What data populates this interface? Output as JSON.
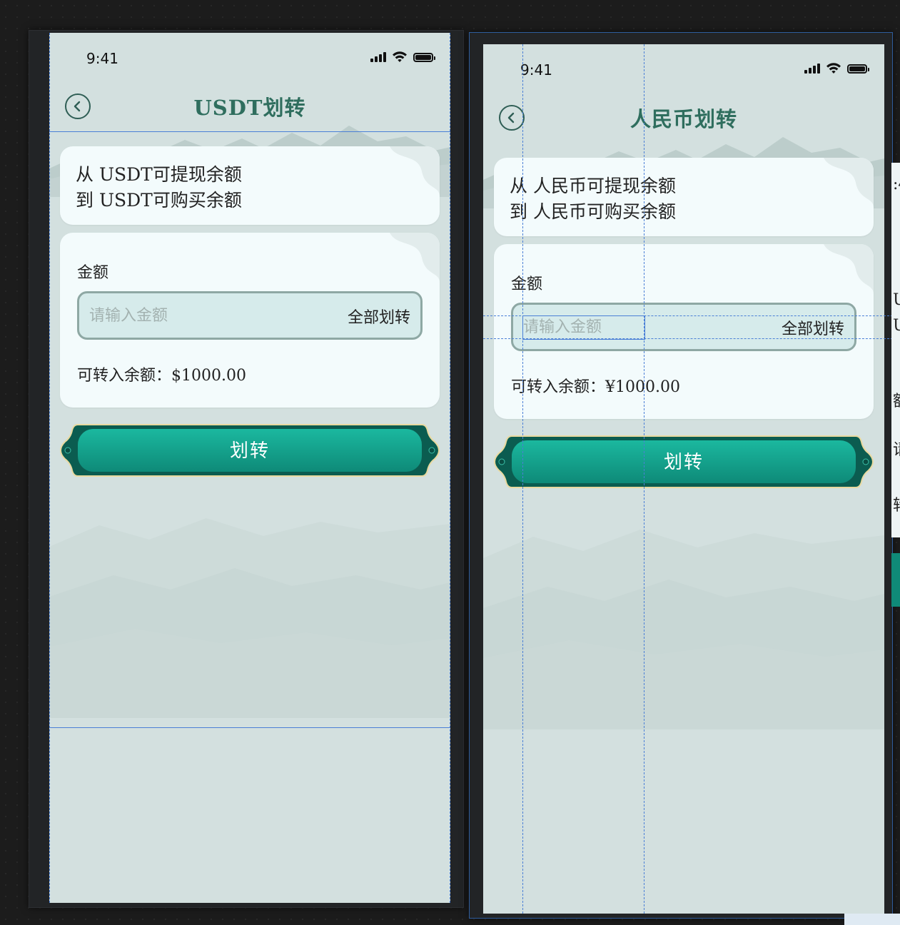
{
  "screens": [
    {
      "status": {
        "time": "9:41"
      },
      "nav": {
        "title": "USDT划转"
      },
      "info": {
        "from_text": "从 USDT可提现余额",
        "to_text": "到 USDT可购买余额"
      },
      "form": {
        "amount_label": "金额",
        "amount_placeholder": "请输入金额",
        "amount_value": "",
        "transfer_all_label": "全部划转",
        "available_text": "可转入余额：$1000.00"
      },
      "submit_label": "划转"
    },
    {
      "status": {
        "time": "9:41"
      },
      "nav": {
        "title": "人民币划转"
      },
      "info": {
        "from_text": "从 人民币可提现余额",
        "to_text": "到 人民币可购买余额"
      },
      "form": {
        "amount_label": "金额",
        "amount_placeholder": "请输入金额",
        "amount_value": "",
        "transfer_all_label": "全部划转",
        "available_text": "可转入余额：¥1000.00"
      },
      "submit_label": "划转"
    }
  ],
  "peek": {
    "glyphs": [
      ":4",
      "U",
      "U",
      "额",
      "请",
      "转"
    ]
  },
  "icons": {
    "back": "chevron-left-icon",
    "signal": "cellular-signal-icon",
    "wifi": "wifi-icon",
    "battery": "battery-icon"
  },
  "colors": {
    "canvas": "#1c1c1c",
    "screen_bg": "#d3e0df",
    "card_bg": "#f3fbfc",
    "title": "#2f6e5e",
    "button_teal": "#11947f",
    "button_gold_border": "#e8d9a0",
    "guide_blue": "#4a7fd6"
  }
}
